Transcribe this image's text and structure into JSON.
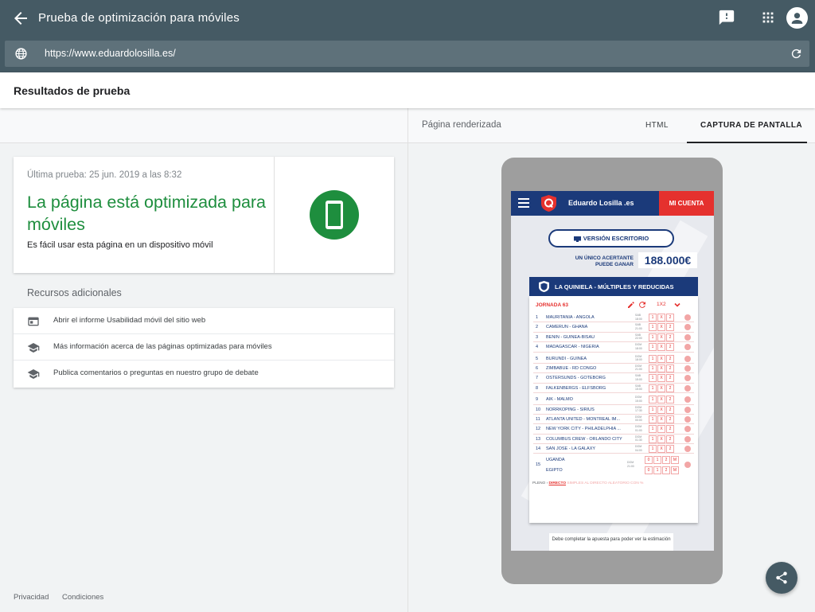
{
  "app": {
    "title": "Prueba de optimización para móviles",
    "url": "https://www.eduardolosilla.es/"
  },
  "results": {
    "title": "Resultados de prueba"
  },
  "summary": {
    "last_test": "Última prueba: 25 jun. 2019 a las 8:32",
    "verdict": "La página está optimizada para móviles",
    "verdict_sub": "Es fácil usar esta página en un dispositivo móvil",
    "accent_color": "#1e8e3e"
  },
  "resources": {
    "title": "Recursos adicionales",
    "items": [
      {
        "label": "Abrir el informe Usabilidad móvil del sitio web",
        "icon": "report-icon"
      },
      {
        "label": "Más información acerca de las páginas optimizadas para móviles",
        "icon": "school-icon"
      },
      {
        "label": "Publica comentarios o preguntas en nuestro grupo de debate",
        "icon": "school-icon"
      }
    ]
  },
  "footer": {
    "privacy": "Privacidad",
    "terms": "Condiciones"
  },
  "preview": {
    "rendered_label": "Página renderizada",
    "tab_html": "HTML",
    "tab_screenshot": "CAPTURA DE PANTALLA"
  },
  "site": {
    "name": "Eduardo Losilla .es",
    "account": "MI CUENTA",
    "desktop_version": "VERSIÓN ESCRITORIO",
    "prize_label_1": "UN ÚNICO ACERTANTE",
    "prize_label_2": "PUEDE GANAR",
    "prize_amount": "188.000€",
    "ticket_title": "LA QUINIELA - MÚLTIPLES Y REDUCIDAS",
    "jornada": "JORNADA 63",
    "bet_type": "1X2",
    "matches": [
      {
        "num": "1",
        "match": "MAURITANIA - ANGOLA",
        "day": "SAB",
        "time": "18:00"
      },
      {
        "num": "2",
        "match": "CAMERÚN - GHANA",
        "day": "SAB",
        "time": "21:00"
      },
      {
        "num": "3",
        "match": "BENIN - GUINEA-BISÁU",
        "day": "SAB",
        "time": "22:00"
      },
      {
        "num": "4",
        "match": "MADAGASCAR - NIGERIA",
        "day": "DOM",
        "time": "18:00"
      },
      {
        "num": "5",
        "match": "BURUNDI - GUINEA",
        "day": "DOM",
        "time": "18:00"
      },
      {
        "num": "6",
        "match": "ZIMBABUE - RD CONGO",
        "day": "DOM",
        "time": "21:00"
      },
      {
        "num": "7",
        "match": "OSTERSUNDS - GOTEBORG",
        "day": "SAB",
        "time": "15:00"
      },
      {
        "num": "8",
        "match": "FALKENBERGS - ELFSBORG",
        "day": "SAB",
        "time": "15:00"
      },
      {
        "num": "9",
        "match": "AIK - MALMO",
        "day": "DOM",
        "time": "15:00"
      },
      {
        "num": "10",
        "match": "NORRKOPING - SIRIUS",
        "day": "DOM",
        "time": "17:30"
      },
      {
        "num": "11",
        "match": "ATLANTA UNITED - MONTREAL IM...",
        "day": "DOM",
        "time": "00:00"
      },
      {
        "num": "12",
        "match": "NEW YORK CITY - PHILADELPHIA ...",
        "day": "DOM",
        "time": "01:00"
      },
      {
        "num": "13",
        "match": "COLUMBUS CREW - ORLANDO CITY",
        "day": "DOM",
        "time": "01:30"
      },
      {
        "num": "14",
        "match": "SAN JOSE - LA GALAXY",
        "day": "DOM",
        "time": "04:00"
      }
    ],
    "pleno": {
      "num": "15",
      "team1": "UGANDA",
      "team2": "EGIPTO",
      "day": "DOM",
      "time": "21:00",
      "options": [
        "0",
        "1",
        "2",
        "M"
      ]
    },
    "signs": [
      "1",
      "X",
      "2"
    ],
    "bet_mode_prefix": "PLENO",
    "bet_mode_active": "DIRECTO",
    "bet_mode_rest": "SIMPLES AL DIRECTO  ALEATORIO  CON %",
    "footer_note": "Debe completar la apuesta para poder ver la estimación",
    "brand_color": "#1b3a7a",
    "red_color": "#e5312e"
  }
}
